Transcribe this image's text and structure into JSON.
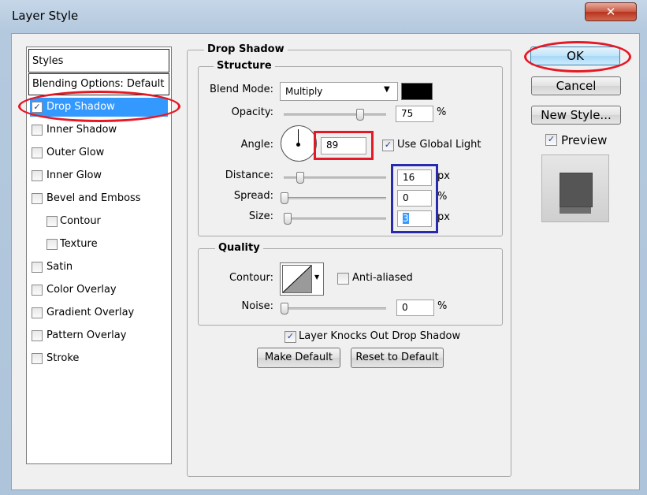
{
  "window": {
    "title": "Layer Style",
    "close_glyph": "✕"
  },
  "styles_panel": {
    "header": "Styles",
    "blending_options": "Blending Options: Default",
    "items": [
      {
        "label": "Drop Shadow",
        "checked": true,
        "selected": true
      },
      {
        "label": "Inner Shadow",
        "checked": false
      },
      {
        "label": "Outer Glow",
        "checked": false
      },
      {
        "label": "Inner Glow",
        "checked": false
      },
      {
        "label": "Bevel and Emboss",
        "checked": false
      },
      {
        "label": "Contour",
        "checked": false,
        "sub": true
      },
      {
        "label": "Texture",
        "checked": false,
        "sub": true
      },
      {
        "label": "Satin",
        "checked": false
      },
      {
        "label": "Color Overlay",
        "checked": false
      },
      {
        "label": "Gradient Overlay",
        "checked": false
      },
      {
        "label": "Pattern Overlay",
        "checked": false
      },
      {
        "label": "Stroke",
        "checked": false
      }
    ]
  },
  "drop_shadow": {
    "title": "Drop Shadow",
    "structure": {
      "title": "Structure",
      "blend_mode_label": "Blend Mode:",
      "blend_mode_value": "Multiply",
      "shadow_color": "#000000",
      "opacity_label": "Opacity:",
      "opacity_value": "75",
      "opacity_unit": "%",
      "angle_label": "Angle:",
      "angle_value": "89",
      "use_global_light": "Use Global Light",
      "distance_label": "Distance:",
      "distance_value": "16",
      "distance_unit": "px",
      "spread_label": "Spread:",
      "spread_value": "0",
      "spread_unit": "%",
      "size_label": "Size:",
      "size_value": "3",
      "size_unit": "px"
    },
    "quality": {
      "title": "Quality",
      "contour_label": "Contour:",
      "anti_aliased": "Anti-aliased",
      "noise_label": "Noise:",
      "noise_value": "0",
      "noise_unit": "%"
    },
    "layer_knocks_out": "Layer Knocks Out Drop Shadow",
    "make_default": "Make Default",
    "reset_to_default": "Reset to Default"
  },
  "right_buttons": {
    "ok": "OK",
    "cancel": "Cancel",
    "new_style": "New Style...",
    "preview": "Preview"
  },
  "colors": {
    "selection": "#3399ff",
    "annotation_red": "#e51925",
    "annotation_blue": "#2a2aae"
  }
}
